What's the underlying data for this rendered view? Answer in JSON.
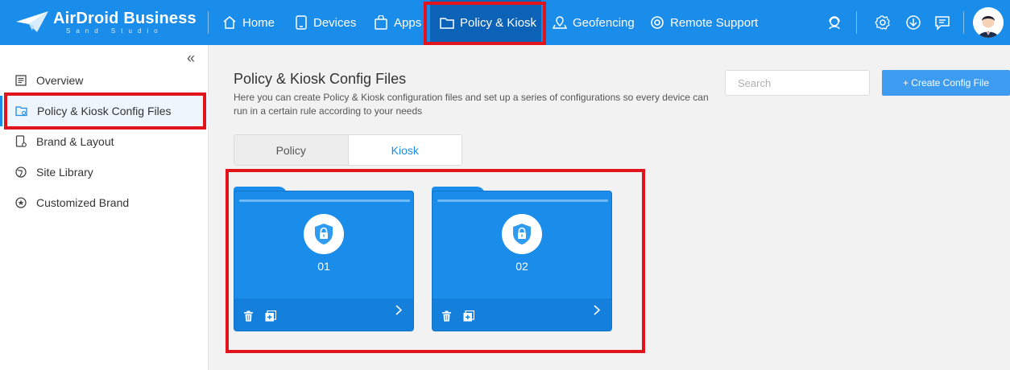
{
  "app": {
    "brand": "AirDroid Business",
    "brand_sub": "Sand Studio"
  },
  "topnav": {
    "items": [
      {
        "label": "Home",
        "icon": "home-icon"
      },
      {
        "label": "Devices",
        "icon": "device-icon"
      },
      {
        "label": "Apps",
        "icon": "apps-bag-icon"
      },
      {
        "label": "Policy & Kiosk",
        "icon": "folder-icon",
        "active": true
      },
      {
        "label": "Geofencing",
        "icon": "geofence-icon"
      },
      {
        "label": "Remote Support",
        "icon": "lifebuoy-icon"
      }
    ],
    "right_icons": [
      "support-agent-icon",
      "settings-gear-icon",
      "download-icon",
      "messages-icon",
      "user-avatar"
    ]
  },
  "sidebar": {
    "items": [
      {
        "label": "Overview",
        "icon": "overview-icon"
      },
      {
        "label": "Policy & Kiosk Config Files",
        "icon": "config-files-icon",
        "active": true
      },
      {
        "label": "Brand & Layout",
        "icon": "brand-layout-icon"
      },
      {
        "label": "Site Library",
        "icon": "site-library-icon"
      },
      {
        "label": "Customized Brand",
        "icon": "customized-brand-icon"
      }
    ]
  },
  "main": {
    "title": "Policy & Kiosk Config Files",
    "description": "Here you can create Policy & Kiosk configuration files and set up a series of configurations so every device can run in a certain rule according to your needs",
    "search_placeholder": "Search",
    "create_button": "+ Create Config File",
    "tabs": [
      {
        "label": "Policy",
        "active": false
      },
      {
        "label": "Kiosk",
        "active": true
      }
    ],
    "folders": [
      {
        "name": "01"
      },
      {
        "name": "02"
      }
    ]
  },
  "colors": {
    "topbar": "#1a8ce9",
    "active_nav": "#0b62b7",
    "highlight": "#e1141c",
    "folder": "#1a8ce9",
    "accent_button": "#3d9bf0"
  }
}
